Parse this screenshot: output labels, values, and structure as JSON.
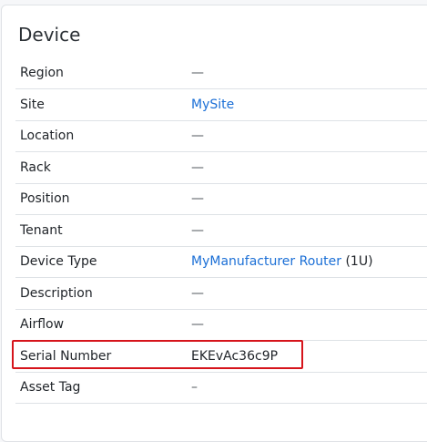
{
  "card": {
    "title": "Device"
  },
  "rows": [
    {
      "label": "Region",
      "value": "—"
    },
    {
      "label": "Site",
      "link": "MySite"
    },
    {
      "label": "Location",
      "value": "—"
    },
    {
      "label": "Rack",
      "value": "—"
    },
    {
      "label": "Position",
      "value": "—"
    },
    {
      "label": "Tenant",
      "value": "—"
    },
    {
      "label": "Device Type",
      "link": "MyManufacturer Router",
      "suffix": " (1U)"
    },
    {
      "label": "Description",
      "value": "—"
    },
    {
      "label": "Airflow",
      "value": "—"
    },
    {
      "label": "Serial Number",
      "value": "EKEvAc36c9P"
    },
    {
      "label": "Asset Tag",
      "value": "–"
    }
  ],
  "colors": {
    "link": "#1b6fd6",
    "highlight": "#d6141b"
  }
}
